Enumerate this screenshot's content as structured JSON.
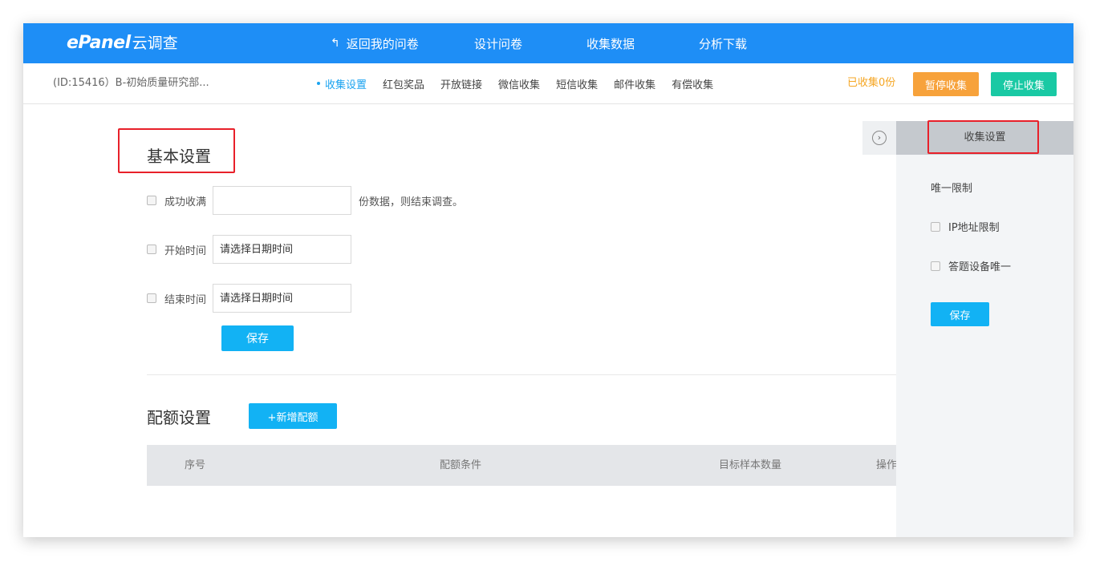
{
  "topbar": {
    "logo_brand": "ePanel",
    "logo_sub": "云调查",
    "nav": [
      "返回我的问卷",
      "设计问卷",
      "收集数据",
      "分析下载"
    ],
    "bg_color": "#1e8ef6"
  },
  "subbar": {
    "survey_id": "(ID:15416）B-初始质量研究部...",
    "tabs": [
      "收集设置",
      "红包奖品",
      "开放链接",
      "微信收集",
      "短信收集",
      "邮件收集",
      "有偿收集"
    ],
    "active_tab": "收集设置",
    "collected": "已收集0份",
    "pause_label": "暂停收集",
    "stop_label": "停止收集"
  },
  "basic": {
    "title": "基本设置",
    "success_label": "成功收满",
    "success_value": "",
    "success_suffix": "份数据，则结束调查。",
    "start_label": "开始时间",
    "start_placeholder": "请选择日期时间",
    "end_label": "结束时间",
    "end_placeholder": "请选择日期时间",
    "save_label": "保存"
  },
  "quota": {
    "title": "配额设置",
    "add_label": "+新增配额",
    "columns": [
      "序号",
      "配额条件",
      "目标样本数量",
      "操作"
    ]
  },
  "right_panel": {
    "head": "收集设置",
    "section": "唯一限制",
    "ip_label": "IP地址限制",
    "device_label": "答题设备唯一",
    "save_label": "保存"
  },
  "colors": {
    "accent": "#12b2f4",
    "pause": "#f7a23b",
    "stop": "#19c9a4",
    "highlight": "#e8202a",
    "collected": "#f5a623"
  },
  "icons": {
    "back": "back-arrow-icon",
    "toggle": "chevron-right-circle-icon"
  }
}
